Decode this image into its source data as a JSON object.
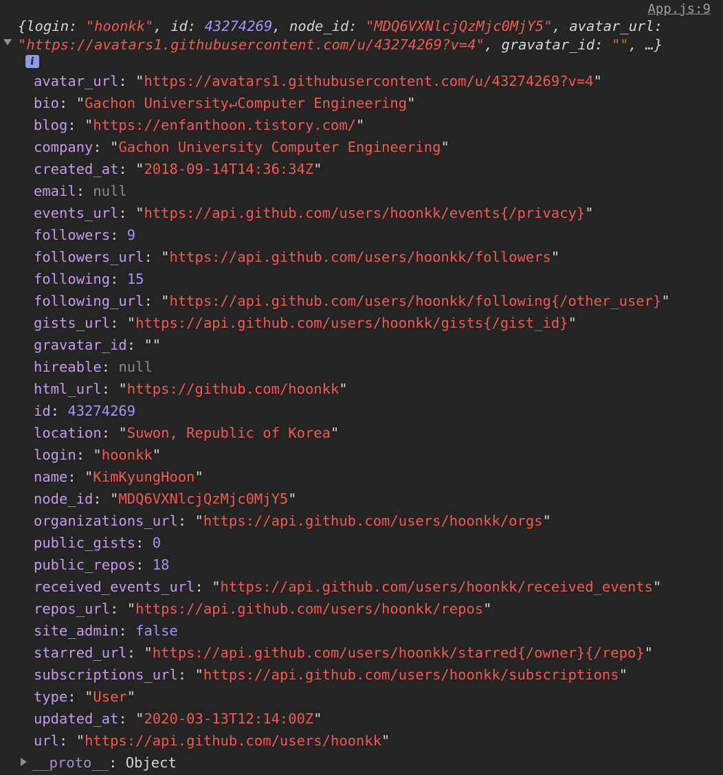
{
  "source_link": "App.js:9",
  "info_badge": "i",
  "preview": {
    "line1": [
      {
        "t": "{",
        "c": "pv-key"
      },
      {
        "t": "login",
        "c": "pv-key"
      },
      {
        "t": ": ",
        "c": "pv-key"
      },
      {
        "t": "\"hoonkk\"",
        "c": "pv-str"
      },
      {
        "t": ", ",
        "c": "pv-key"
      },
      {
        "t": "id",
        "c": "pv-key"
      },
      {
        "t": ": ",
        "c": "pv-key"
      },
      {
        "t": "43274269",
        "c": "pv-num"
      },
      {
        "t": ", ",
        "c": "pv-key"
      },
      {
        "t": "node_id",
        "c": "pv-key"
      },
      {
        "t": ": ",
        "c": "pv-key"
      },
      {
        "t": "\"MDQ6VXNlcjQzMjc0MjY5\"",
        "c": "pv-str"
      },
      {
        "t": ", ",
        "c": "pv-key"
      },
      {
        "t": "avatar_url",
        "c": "pv-key"
      },
      {
        "t": ":",
        "c": "pv-key"
      }
    ],
    "line2": [
      {
        "t": "\"https://avatars1.githubusercontent.com/u/43274269?v=4\"",
        "c": "pv-str"
      },
      {
        "t": ", ",
        "c": "pv-key"
      },
      {
        "t": "gravatar_id",
        "c": "pv-key"
      },
      {
        "t": ": ",
        "c": "pv-key"
      },
      {
        "t": "\"\"",
        "c": "pv-str"
      },
      {
        "t": ", …}",
        "c": "pv-key"
      }
    ]
  },
  "properties": [
    {
      "key": "avatar_url",
      "type": "string",
      "value": "https://avatars1.githubusercontent.com/u/43274269?v=4"
    },
    {
      "key": "bio",
      "type": "string",
      "value": "Gachon University↵Computer Engineering"
    },
    {
      "key": "blog",
      "type": "string",
      "value": "https://enfanthoon.tistory.com/"
    },
    {
      "key": "company",
      "type": "string",
      "value": "Gachon University Computer Engineering"
    },
    {
      "key": "created_at",
      "type": "string",
      "value": "2018-09-14T14:36:34Z"
    },
    {
      "key": "email",
      "type": "null",
      "value": "null"
    },
    {
      "key": "events_url",
      "type": "string",
      "value": "https://api.github.com/users/hoonkk/events{/privacy}"
    },
    {
      "key": "followers",
      "type": "number",
      "value": "9"
    },
    {
      "key": "followers_url",
      "type": "string",
      "value": "https://api.github.com/users/hoonkk/followers"
    },
    {
      "key": "following",
      "type": "number",
      "value": "15"
    },
    {
      "key": "following_url",
      "type": "string",
      "value": "https://api.github.com/users/hoonkk/following{/other_user}"
    },
    {
      "key": "gists_url",
      "type": "string",
      "value": "https://api.github.com/users/hoonkk/gists{/gist_id}"
    },
    {
      "key": "gravatar_id",
      "type": "string",
      "value": ""
    },
    {
      "key": "hireable",
      "type": "null",
      "value": "null"
    },
    {
      "key": "html_url",
      "type": "string",
      "value": "https://github.com/hoonkk"
    },
    {
      "key": "id",
      "type": "number",
      "value": "43274269"
    },
    {
      "key": "location",
      "type": "string",
      "value": "Suwon, Republic of Korea"
    },
    {
      "key": "login",
      "type": "string",
      "value": "hoonkk"
    },
    {
      "key": "name",
      "type": "string",
      "value": "KimKyungHoon"
    },
    {
      "key": "node_id",
      "type": "string",
      "value": "MDQ6VXNlcjQzMjc0MjY5"
    },
    {
      "key": "organizations_url",
      "type": "string",
      "value": "https://api.github.com/users/hoonkk/orgs"
    },
    {
      "key": "public_gists",
      "type": "number",
      "value": "0"
    },
    {
      "key": "public_repos",
      "type": "number",
      "value": "18"
    },
    {
      "key": "received_events_url",
      "type": "string",
      "value": "https://api.github.com/users/hoonkk/received_events"
    },
    {
      "key": "repos_url",
      "type": "string",
      "value": "https://api.github.com/users/hoonkk/repos"
    },
    {
      "key": "site_admin",
      "type": "bool",
      "value": "false"
    },
    {
      "key": "starred_url",
      "type": "string",
      "value": "https://api.github.com/users/hoonkk/starred{/owner}{/repo}"
    },
    {
      "key": "subscriptions_url",
      "type": "string",
      "value": "https://api.github.com/users/hoonkk/subscriptions"
    },
    {
      "key": "type",
      "type": "string",
      "value": "User"
    },
    {
      "key": "updated_at",
      "type": "string",
      "value": "2020-03-13T12:14:00Z"
    },
    {
      "key": "url",
      "type": "string",
      "value": "https://api.github.com/users/hoonkk"
    }
  ],
  "proto": {
    "key": "__proto__",
    "value": "Object"
  },
  "colors": {
    "background": "#242424",
    "key": "#c59be8",
    "string": "#ee5a52",
    "number": "#9f96f5",
    "null": "#8a8a8a",
    "text": "#d5d5d5"
  }
}
